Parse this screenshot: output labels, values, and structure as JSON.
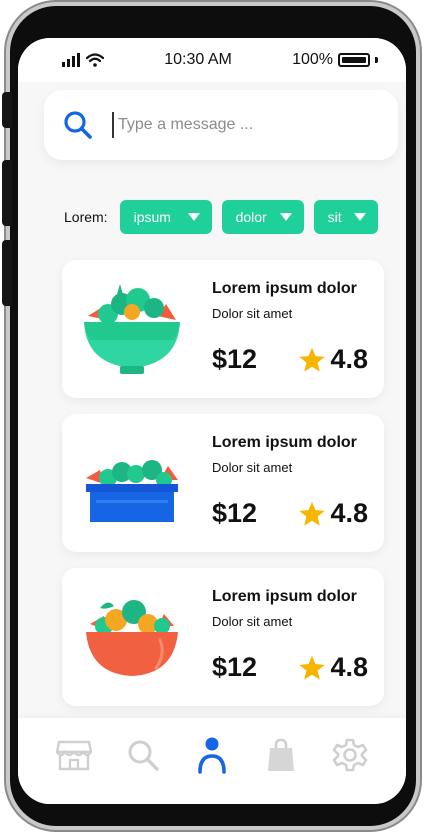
{
  "status_bar": {
    "time": "10:30 AM",
    "battery": "100%"
  },
  "search": {
    "placeholder": "Type a message ..."
  },
  "filters": {
    "label": "Lorem:",
    "chips": [
      {
        "label": "ipsum"
      },
      {
        "label": "dolor"
      },
      {
        "label": "sit"
      }
    ]
  },
  "products": [
    {
      "title": "Lorem ipsum dolor",
      "subtitle": "Dolor sit amet",
      "price": "$12",
      "rating": "4.8",
      "icon": "salad-bowl-icon"
    },
    {
      "title": "Lorem ipsum dolor",
      "subtitle": "Dolor sit amet",
      "price": "$12",
      "rating": "4.8",
      "icon": "salad-tray-icon"
    },
    {
      "title": "Lorem ipsum dolor",
      "subtitle": "Dolor sit amet",
      "price": "$12",
      "rating": "4.8",
      "icon": "fruit-bowl-icon"
    }
  ],
  "bottom_nav": {
    "items": [
      {
        "icon": "store-icon",
        "active": false
      },
      {
        "icon": "search-icon",
        "active": false
      },
      {
        "icon": "user-icon",
        "active": true
      },
      {
        "icon": "shopping-bag-icon",
        "active": false
      },
      {
        "icon": "gear-icon",
        "active": false
      }
    ]
  },
  "colors": {
    "accent": "#1fd09b",
    "primary_blue": "#1565e5",
    "star": "#f7b500",
    "inactive": "#cfcfcf"
  }
}
